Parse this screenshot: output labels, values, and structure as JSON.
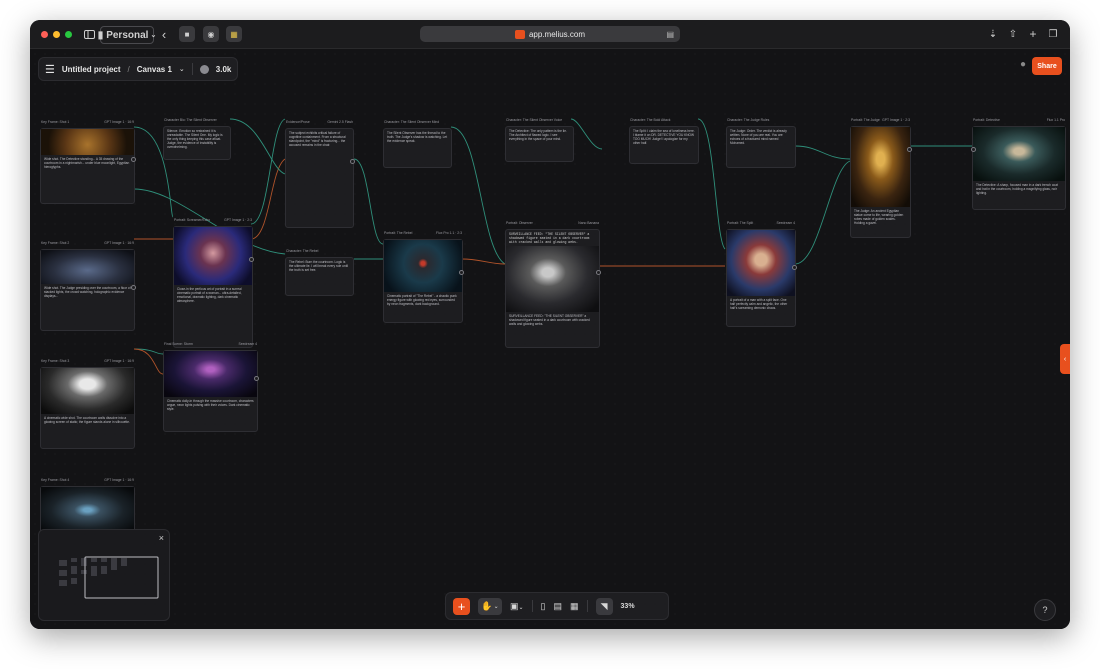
{
  "browser": {
    "profile_label": "Personal",
    "url": "app.melius.com"
  },
  "header": {
    "project": "Untitled project",
    "separator": "/",
    "canvas": "Canvas 1",
    "credits": "3.0k",
    "share_label": "Share"
  },
  "toolbar": {
    "zoom": "33%"
  },
  "colors": {
    "accent": "#e8501e",
    "edge_green": "#2f8f7a",
    "edge_orange": "#b0532a"
  },
  "nodes": [
    {
      "id": "n1",
      "title": "Key Frame: Shot 1",
      "meta": "GPT Image 1 · 16:9",
      "text": "Wide shot. The Detective standing... A 35 drawing of the courtroom in a nightmarish... under blue moonlight, Egyptian hieroglyphs."
    },
    {
      "id": "n2",
      "title": "Character Bio: The Silent Observer",
      "meta": "",
      "text": "Silence. Emotion so restrained it is unreadable. The Silent One. My logic is the only thing keeping this case afloat. Judge, the evidence of instability is overwhelming."
    },
    {
      "id": "n3",
      "title": "Portrait: Screamer/Echo",
      "meta": "GPT Image 1 · 2:3",
      "text": "Close-in the perilous art of portrait in a surreal cinematic portrait of a woman... ultra-detailed, emotional, dramatic lighting, dark cinematic atmosphere."
    },
    {
      "id": "n4",
      "title": "Key Frame: Shot 2",
      "meta": "GPT Image 1 · 16:9",
      "text": "Wide shot. The Judge presiding over the courtroom, a floor of stacked lights, the crowd watching, holographic evidence displays..."
    },
    {
      "id": "n5",
      "title": "Evidence/Prose",
      "meta": "Gemini 2.5 Flash",
      "text": "The subject exhibits critical failure of cognitive containment. From a structural standpoint, the \"mind\" is fracturing... the accused remains in the chair."
    },
    {
      "id": "n6",
      "title": "Character: The Rebel",
      "meta": "",
      "text": "The Rebel: Burn the courtroom. Logic is the ultimate lie. I will break every rule until the truth is set free."
    },
    {
      "id": "n7",
      "title": "Character: The Silent Observer Mind",
      "meta": "",
      "text": "The Silent Observer has the thread to the truth. The Judge's shadow is watching. Let the evidence speak."
    },
    {
      "id": "n8",
      "title": "Portrait: The Rebel",
      "meta": "Flux Pro 1.1 · 2:3",
      "text": "Cinematic portrait of \"The Rebel\" - a chaotic punk energy figure with glowing red eyes, surrounded by neon fragments, dark background."
    },
    {
      "id": "n9",
      "title": "Character: The Silent Observer Voice",
      "meta": "",
      "text": "The Detective: The only pattern is the lie. The Architect of flawed logic. I see everything in the space of your mind."
    },
    {
      "id": "n10",
      "title": "Portrait: Observer",
      "meta": "Nano Banana",
      "text": "SURVEILLANCE FEED: \"THE SILENT OBSERVER\" a shadowed figure seated in a dark courtroom with cracked walls and glowing webs."
    },
    {
      "id": "n11",
      "title": "Character: The Bold Attack",
      "meta": "",
      "text": "The Split: I claim the sea of loneliness here. I blame it on DR. DETECTIVE YOU KNOW TOO MUCH! Judge! I apologize for my other half."
    },
    {
      "id": "n12",
      "title": "Portrait: The Split",
      "meta": "Seedream 4",
      "text": "A portrait of a man with a split face. One half perfectly calm and angelic, the other half's screaming demonic chaos."
    },
    {
      "id": "n13",
      "title": "Character: The Judge Rules",
      "meta": "",
      "text": "The Judge: Order. The verdict is already written. None of you are real. You are echoes of a fractured mind named Mohamed."
    },
    {
      "id": "n14",
      "title": "Portrait: The Judge",
      "meta": "GPT Image 1 · 2:3",
      "text": "The Judge: An ancient Egyptian statue come to life, wearing golden robes made of golden scales. Holding a gavel."
    },
    {
      "id": "n15",
      "title": "Portrait: Detective",
      "meta": "Flux 1.1 Pro",
      "text": "The Detective: A sharp, focused man in a dark trench coat and hat in the courtroom, holding a magnifying glass, noir lighting."
    },
    {
      "id": "n16",
      "title": "Key Frame: Shot 3",
      "meta": "GPT Image 1 · 16:9",
      "text": "A cinematic wide shot. The courtroom walls dissolve into a glowing screen of static; the figure stands alone in silhouette."
    },
    {
      "id": "n17",
      "title": "Final Scene: Storm",
      "meta": "Seedream 4",
      "text": "Cinematic dolly-in through the massive courtroom, characters argue, neon lights pulsing with their voices. Dark cinematic style."
    },
    {
      "id": "n18",
      "title": "Key Frame: Shot 4",
      "meta": "GPT Image 1 · 16:9",
      "text": "Close-up of the eyes. A man, Mohamed, reflected in the computer screen. The eyes wide, pupils reflecting the last frame."
    }
  ]
}
